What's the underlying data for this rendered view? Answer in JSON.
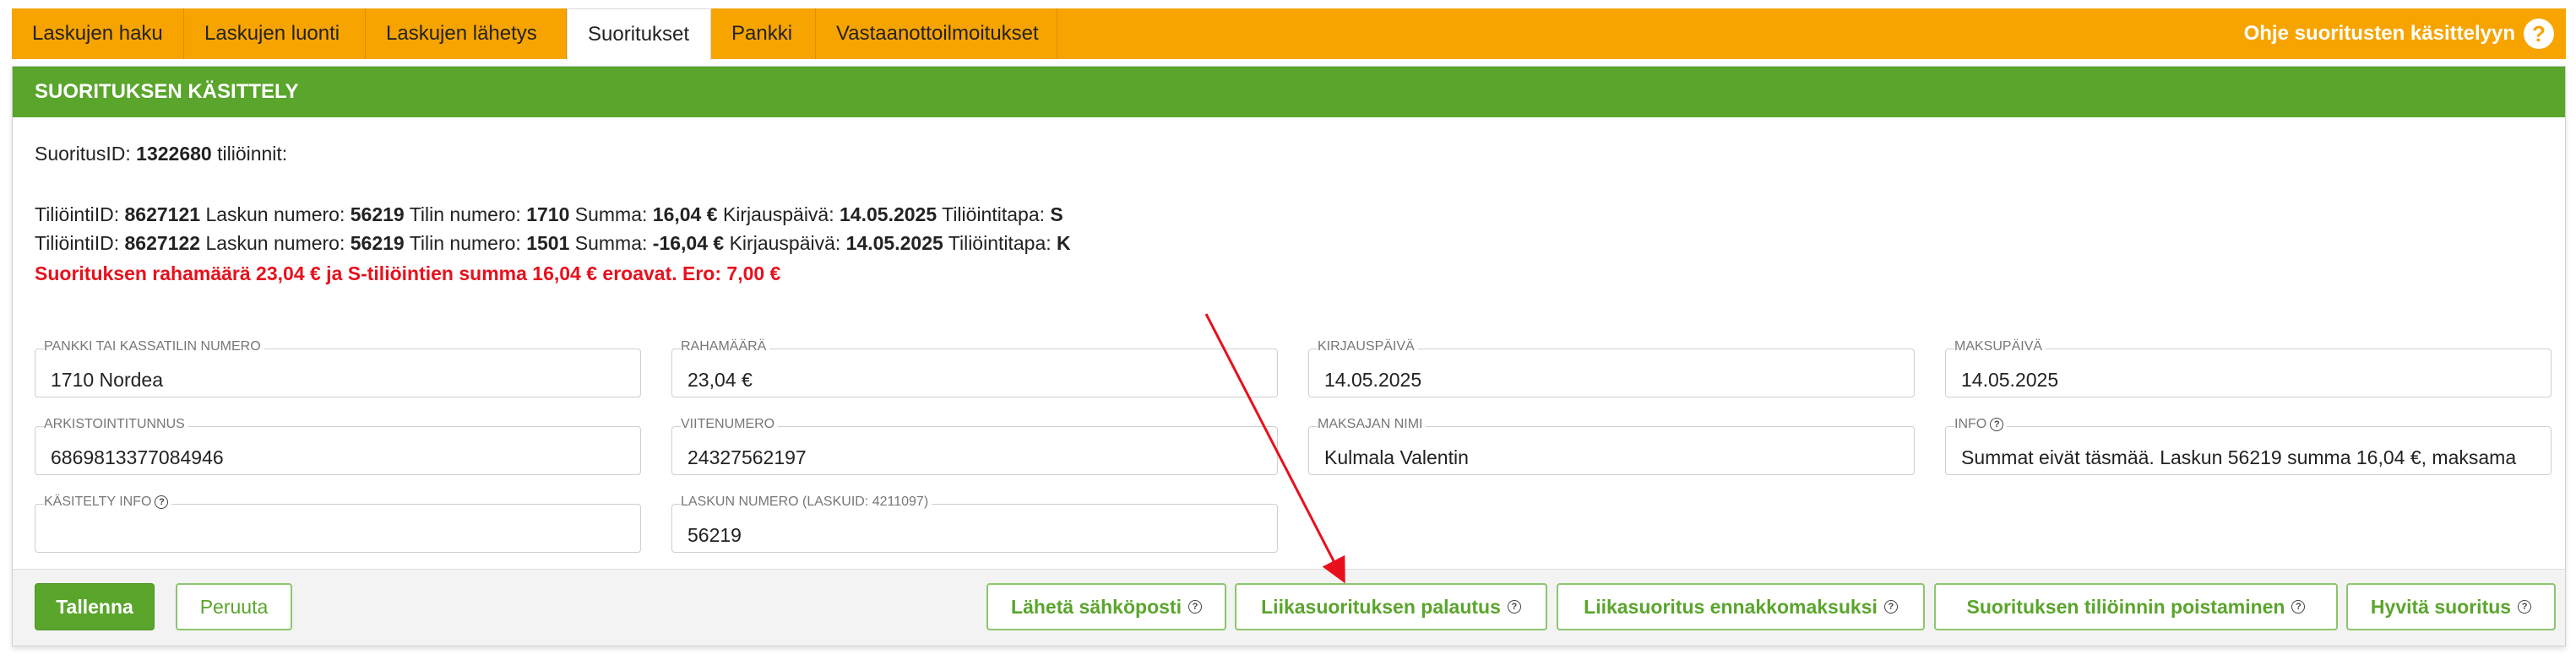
{
  "tabs": [
    {
      "label": "Laskujen haku"
    },
    {
      "label": "Laskujen luonti"
    },
    {
      "label": "Laskujen lähetys"
    },
    {
      "label": "Suoritukset"
    },
    {
      "label": "Pankki"
    },
    {
      "label": "Vastaanottoilmoitukset"
    }
  ],
  "active_tab": "Suoritukset",
  "help": {
    "label": "Ohje suoritusten käsittelyyn",
    "icon": "question-icon"
  },
  "panel": {
    "title": "SUORITUKSEN KÄSITTELY",
    "suoritus": {
      "prefix": "SuoritusID:",
      "id": "1322680",
      "suffix": "tiliöinnit:"
    },
    "tilioinnit": [
      {
        "id_label": "TiliöintiID:",
        "id": "8627121",
        "invoice_label": "Laskun numero:",
        "invoice": "56219",
        "account_label": "Tilin numero:",
        "account": "1710",
        "sum_label": "Summa:",
        "sum": "16,04 €",
        "date_label": "Kirjauspäivä:",
        "date": "14.05.2025",
        "method_label": "Tiliöintitapa:",
        "method": "S"
      },
      {
        "id_label": "TiliöintiID:",
        "id": "8627122",
        "invoice_label": "Laskun numero:",
        "invoice": "56219",
        "account_label": "Tilin numero:",
        "account": "1501",
        "sum_label": "Summa:",
        "sum": "-16,04 €",
        "date_label": "Kirjauspäivä:",
        "date": "14.05.2025",
        "method_label": "Tiliöintitapa:",
        "method": "K"
      }
    ],
    "warning": "Suorituksen rahamäärä 23,04 € ja S-tiliöintien summa 16,04 € eroavat. Ero: 7,00 €"
  },
  "fields": {
    "bank_account": {
      "label": "PANKKI TAI KASSATILIN NUMERO",
      "value": "1710 Nordea"
    },
    "amount": {
      "label": "RAHAMÄÄRÄ",
      "value": "23,04 €"
    },
    "booking_date": {
      "label": "KIRJAUSPÄIVÄ",
      "value": "14.05.2025"
    },
    "payment_date": {
      "label": "MAKSUPÄIVÄ",
      "value": "14.05.2025"
    },
    "archive_id": {
      "label": "ARKISTOINTITUNNUS",
      "value": "6869813377084946"
    },
    "reference": {
      "label": "VIITENUMERO",
      "value": "24327562197"
    },
    "payer_name": {
      "label": "MAKSAJAN NIMI",
      "value": "Kulmala Valentin"
    },
    "info": {
      "label": "INFO",
      "value": "Summat eivät täsmää. Laskun 56219 summa 16,04 €, maksama"
    },
    "handled_info": {
      "label": "KÄSITELTY INFO",
      "value": ""
    },
    "invoice_number": {
      "label": "LASKUN NUMERO (LASKUID: 4211097)",
      "value": "56219"
    }
  },
  "buttons": {
    "save": "Tallenna",
    "cancel": "Peruuta",
    "send_email": "Lähetä sähköposti",
    "overpayment_refund": "Liikasuorituksen palautus",
    "overpayment_prepayment": "Liikasuoritus ennakkomaksuksi",
    "remove_posting": "Suorituksen tiliöinnin poistaminen",
    "credit_payment": "Hyvitä suoritus"
  },
  "colors": {
    "tabbar": "#f7a400",
    "header_green": "#5aa52c",
    "warning_red": "#e8101c",
    "annotation_arrow": "#e8101c"
  }
}
